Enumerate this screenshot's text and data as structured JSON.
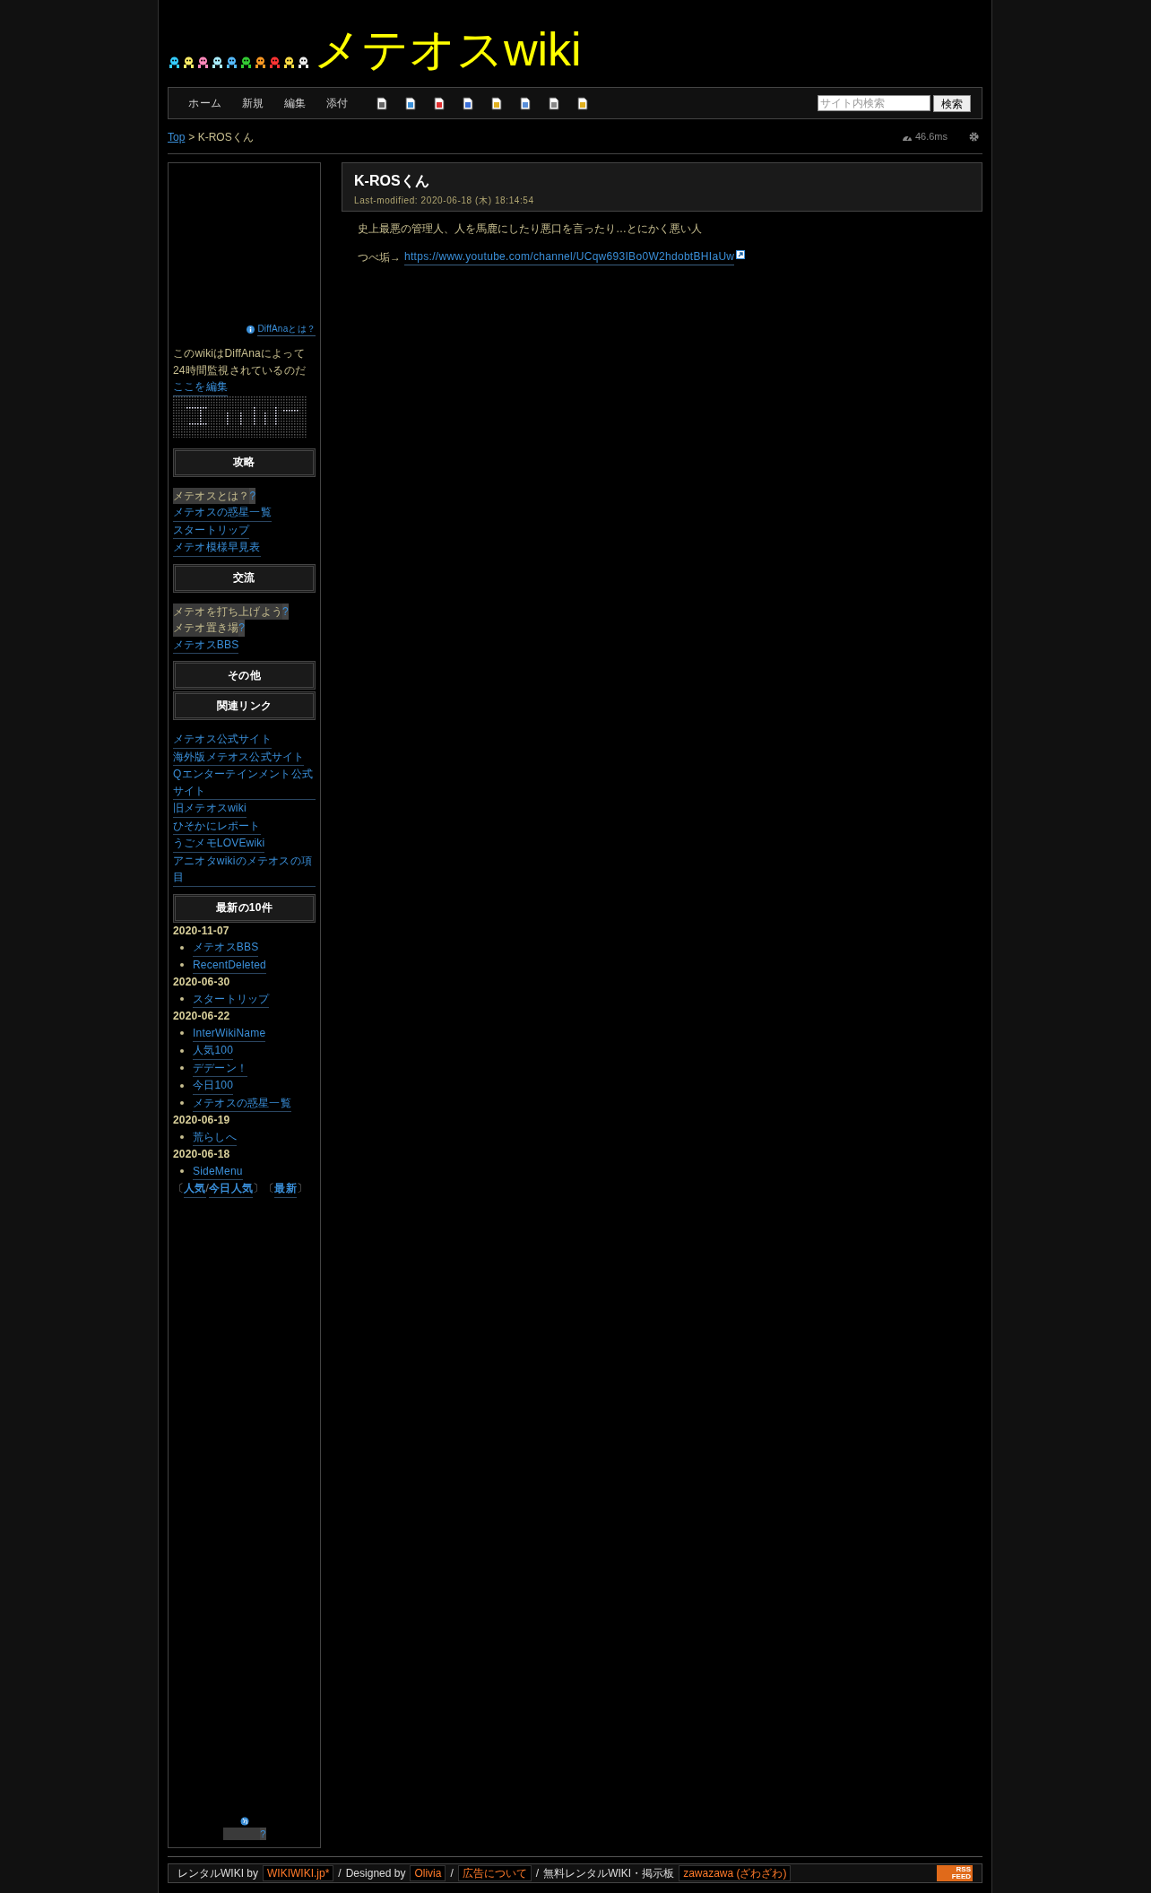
{
  "header": {
    "title": "メテオスwiki"
  },
  "nav": {
    "items": [
      "ホーム",
      "新規",
      "編集",
      "添付"
    ],
    "search": {
      "placeholder": "サイト内検索",
      "button": "検索"
    }
  },
  "breadcrumb": {
    "link": "Top",
    "separator": ">",
    "current": "K-ROSくん",
    "timing": "46.6ms"
  },
  "sidebar": {
    "diffana_link": "DiffAnaとは？",
    "notice": "このwikiはDiffAnaによって24時間監視されているのだ",
    "edit_link": "ここを編集",
    "sections": [
      {
        "heading": "攻略",
        "links": [
          {
            "text": "メテオスとは？",
            "missing": true,
            "mark": "?"
          },
          {
            "text": "メテオスの惑星一覧",
            "missing": false
          },
          {
            "text": "スタートリップ",
            "missing": false
          },
          {
            "text": "メテオ模様早見表",
            "missing": false
          }
        ]
      },
      {
        "heading": "交流",
        "links": [
          {
            "text": "メテオを打ち上げよう",
            "missing": true,
            "mark": "?"
          },
          {
            "text": "メテオ置き場",
            "missing": true,
            "mark": "?"
          },
          {
            "text": "メテオスBBS",
            "missing": false
          }
        ]
      },
      {
        "heading": "その他"
      },
      {
        "heading": "関連リンク",
        "links": [
          {
            "text": "メテオス公式サイト",
            "missing": false
          },
          {
            "text": "海外版メテオス公式サイト",
            "missing": false
          },
          {
            "text": "Qエンターテインメント公式サイト",
            "missing": false
          },
          {
            "text": "旧メテオスwiki",
            "missing": false
          },
          {
            "text": "ひそかにレポート",
            "missing": false
          },
          {
            "text": "うごメモLOVEwiki",
            "missing": false
          },
          {
            "text": "アニオタwikiのメテオスの項目",
            "missing": false
          }
        ]
      }
    ],
    "recent": {
      "heading": "最新の10件",
      "groups": [
        {
          "date": "2020-11-07",
          "items": [
            "メテオスBBS",
            "RecentDeleted"
          ]
        },
        {
          "date": "2020-06-30",
          "items": [
            "スタートリップ"
          ]
        },
        {
          "date": "2020-06-22",
          "items": [
            "InterWikiName",
            "人気100",
            "デデーン！",
            "今日100",
            "メテオスの惑星一覧"
          ]
        },
        {
          "date": "2020-06-19",
          "items": [
            "荒らしへ"
          ]
        },
        {
          "date": "2020-06-18",
          "items": [
            "SideMenu"
          ]
        }
      ],
      "footer": [
        {
          "kind": "text",
          "text": "〔"
        },
        {
          "kind": "link",
          "text": "人気"
        },
        {
          "kind": "text",
          "text": "/"
        },
        {
          "kind": "link",
          "text": "今日人気"
        },
        {
          "kind": "text",
          "text": "〕"
        },
        {
          "kind": "text",
          "text": "〔"
        },
        {
          "kind": "link",
          "text": "最新"
        },
        {
          "kind": "text",
          "text": "〕"
        }
      ]
    },
    "bottom_mark": "?"
  },
  "page": {
    "title": "K-ROSくん",
    "modified": "Last-modified: 2020-06-18 (木) 18:14:54",
    "paragraph": "史上最悪の管理人、人を馬鹿にしたり悪口を言ったり…とにかく悪い人",
    "link_label": "つべ垢→",
    "link": "https://www.youtube.com/channel/UCqw693IBo0W2hdobtBHIaUw"
  },
  "footer": [
    {
      "kind": "text",
      "text": "レンタルWIKI by"
    },
    {
      "kind": "link",
      "text": "WIKIWIKI.jp*"
    },
    {
      "kind": "text",
      "text": "/"
    },
    {
      "kind": "text",
      "text": "Designed by"
    },
    {
      "kind": "link",
      "text": "Olivia"
    },
    {
      "kind": "text",
      "text": "/"
    },
    {
      "kind": "link",
      "text": "広告について"
    },
    {
      "kind": "text",
      "text": "/"
    },
    {
      "kind": "text",
      "text": "無料レンタルWIKI・掲示板"
    },
    {
      "kind": "link",
      "text": "zawazawa (ざわざわ)"
    }
  ],
  "rss": [
    "RSS",
    "FEED"
  ]
}
